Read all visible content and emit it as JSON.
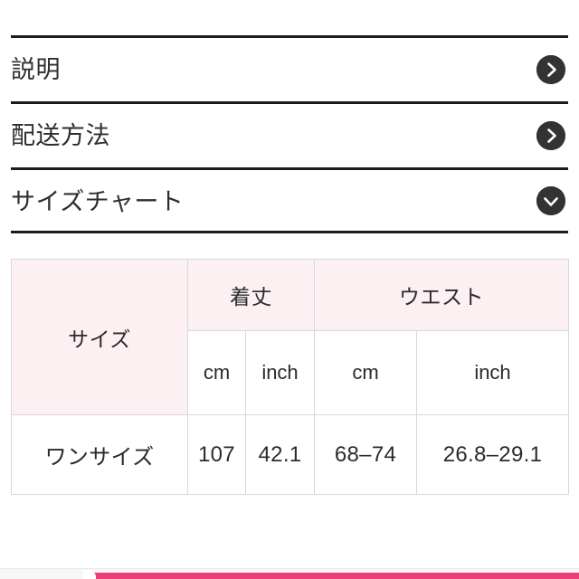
{
  "accordion": {
    "sections": [
      {
        "title": "説明",
        "icon": "chevron-right-icon",
        "expanded": false
      },
      {
        "title": "配送方法",
        "icon": "chevron-right-icon",
        "expanded": false
      },
      {
        "title": "サイズチャート",
        "icon": "chevron-down-icon",
        "expanded": true
      }
    ]
  },
  "size_chart": {
    "headers": {
      "size": "サイズ",
      "groups": [
        {
          "label": "着丈",
          "units": [
            "cm",
            "inch"
          ]
        },
        {
          "label": "ウエスト",
          "units": [
            "cm",
            "inch"
          ]
        }
      ]
    },
    "rows": [
      {
        "size": "ワンサイズ",
        "length_cm": "107",
        "length_inch": "42.1",
        "waist_cm": "68–74",
        "waist_inch": "26.8–29.1"
      }
    ]
  },
  "colors": {
    "rule": "#1c1c1c",
    "header_pink": "#fcf0f2",
    "table_border": "#d8d8d8",
    "accent_pink": "#ec3f79",
    "icon_circle": "#333333"
  }
}
